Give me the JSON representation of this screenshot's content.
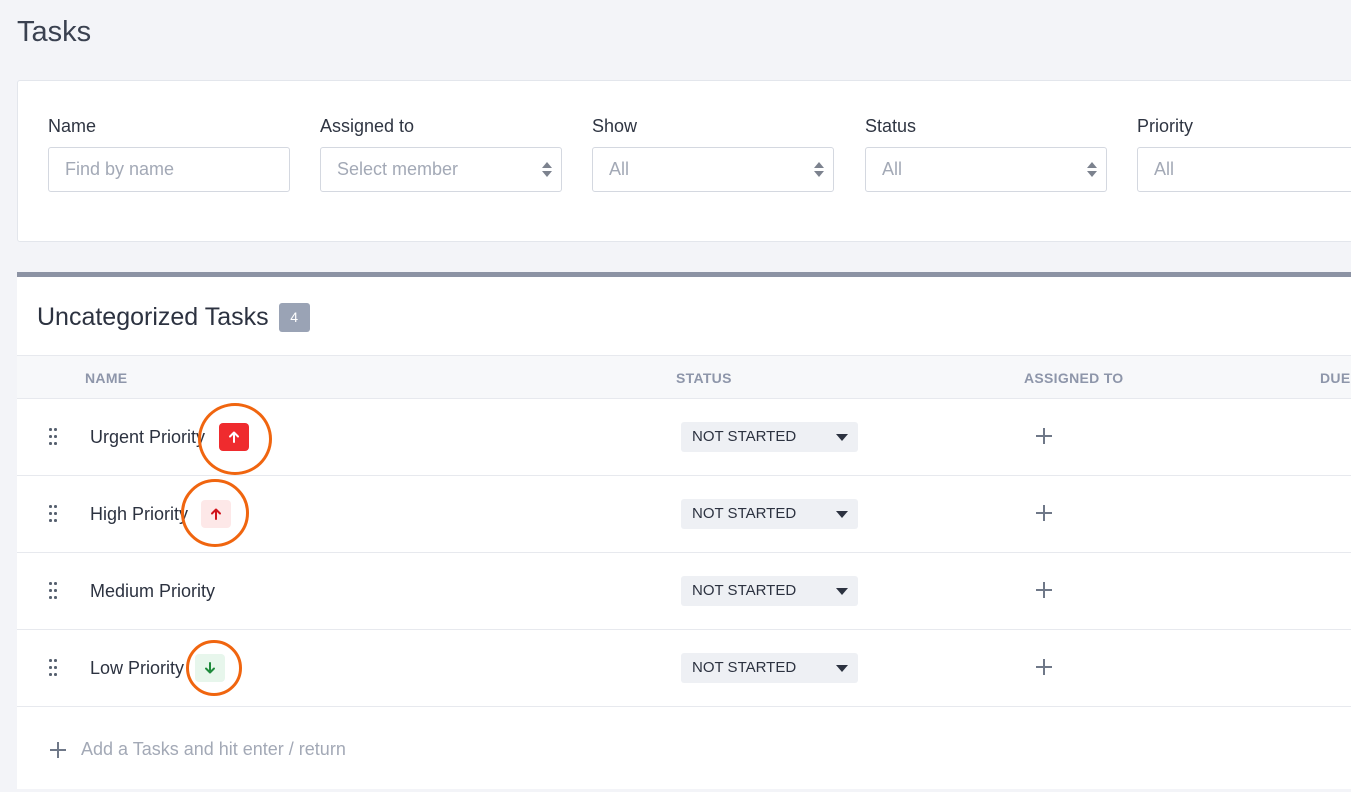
{
  "page": {
    "title": "Tasks"
  },
  "filters": [
    {
      "label": "Name",
      "value": "",
      "placeholder": "Find by name",
      "type": "text"
    },
    {
      "label": "Assigned to",
      "placeholder": "Select member",
      "type": "select"
    },
    {
      "label": "Show",
      "placeholder": "All",
      "type": "select"
    },
    {
      "label": "Status",
      "placeholder": "All",
      "type": "select"
    },
    {
      "label": "Priority",
      "placeholder": "All",
      "type": "select"
    }
  ],
  "section": {
    "title": "Uncategorized Tasks",
    "count": "4",
    "columns": [
      "NAME",
      "STATUS",
      "ASSIGNED TO",
      "DUE"
    ]
  },
  "tasks": [
    {
      "name": "Urgent Priority",
      "status": "NOT STARTED",
      "priority": "urgent",
      "priority_icon": "arrow-up-icon",
      "priority_color": "#ef2b2e"
    },
    {
      "name": "High Priority",
      "status": "NOT STARTED",
      "priority": "high",
      "priority_icon": "arrow-up-icon",
      "priority_color": "#d0121b"
    },
    {
      "name": "Medium Priority",
      "status": "NOT STARTED",
      "priority": "medium"
    },
    {
      "name": "Low Priority",
      "status": "NOT STARTED",
      "priority": "low",
      "priority_icon": "arrow-down-icon",
      "priority_color": "#1f8a3c"
    }
  ],
  "add_task": {
    "placeholder": "Add a Tasks and hit enter / return"
  },
  "colors": {
    "accent_ring": "#f0650f",
    "section_border": "#8c93a4",
    "badge": "#9aa3b5"
  }
}
